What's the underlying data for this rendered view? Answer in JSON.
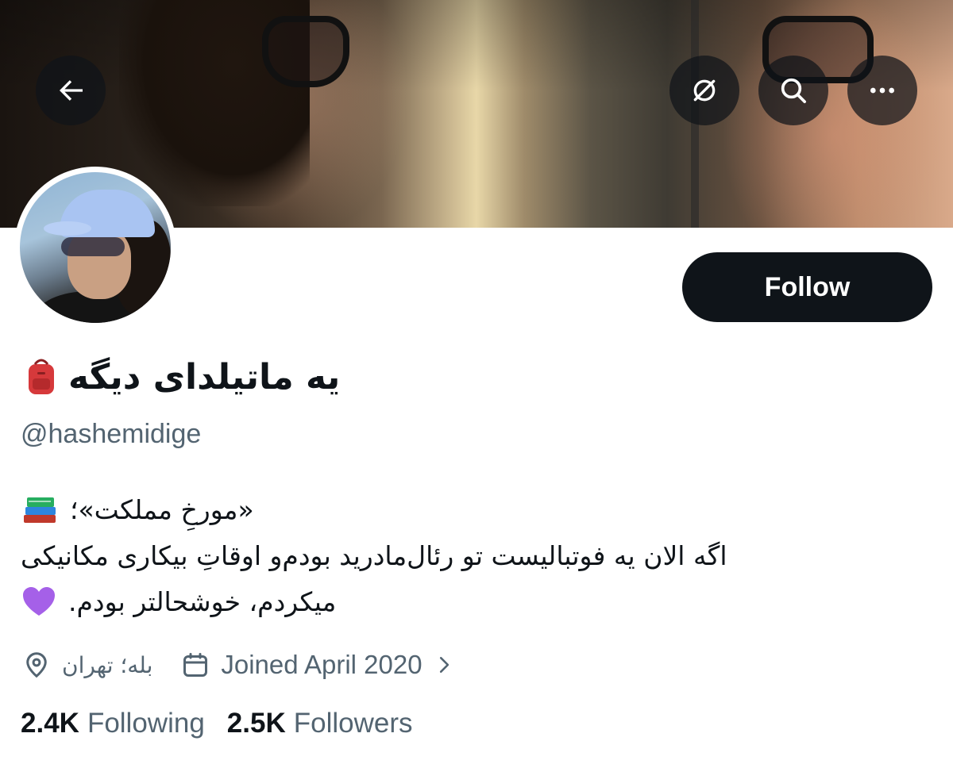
{
  "header": {
    "back_icon": "arrow-left-icon",
    "hide_icon": "eye-slash-icon",
    "search_icon": "search-icon",
    "more_icon": "more-horizontal-icon",
    "button_background": "#0f1419"
  },
  "profile": {
    "display_name": "یه ماتیلدای دیگه",
    "name_emoji": "backpack-emoji",
    "handle": "@hashemidige",
    "follow_label": "Follow",
    "bio": {
      "line1": "«مورخِ مملکت»؛",
      "line1_emoji": "books-emoji",
      "line2": "اگه الان یه فوتبالیست تو رئال‌مادرید بودم‌و اوقاتِ بیکاری مکانیکی",
      "line3": "میکردم، خوشحالتر بودم.",
      "line3_emoji": "purple-heart-emoji"
    },
    "location": "بله؛ تهران",
    "joined": "Joined April 2020",
    "following_count": "2.4K",
    "following_label": "Following",
    "followers_count": "2.5K",
    "followers_label": "Followers"
  },
  "colors": {
    "text_primary": "#0f1419",
    "text_secondary": "#536471",
    "follow_bg": "#0f1419",
    "follow_text": "#ffffff"
  }
}
